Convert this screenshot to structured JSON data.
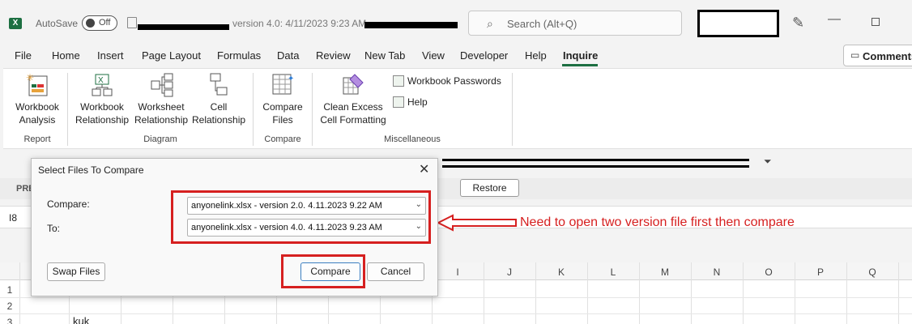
{
  "titlebar": {
    "app_icon": "X",
    "autosave_label": "AutoSave",
    "autosave_state": "Off",
    "doc_title": "version 4.0: 4/11/2023 9:23 AM",
    "search_placeholder": "Search (Alt+Q)",
    "icons": [
      "excel-icon",
      "save-icon",
      "search-icon",
      "pen-icon",
      "minimize-icon",
      "maximize-icon"
    ]
  },
  "menu": {
    "tabs": [
      "File",
      "Home",
      "Insert",
      "Page Layout",
      "Formulas",
      "Data",
      "Review",
      "New Tab",
      "View",
      "Developer",
      "Help",
      "Inquire"
    ],
    "active_tab": "Inquire",
    "comments_label": "Comments"
  },
  "ribbon": {
    "groups": {
      "report": "Report",
      "diagram": "Diagram",
      "compare": "Compare",
      "misc": "Miscellaneous"
    },
    "buttons": {
      "workbook_analysis": [
        "Workbook",
        "Analysis"
      ],
      "workbook_relationship": [
        "Workbook",
        "Relationship"
      ],
      "worksheet_relationship": [
        "Worksheet",
        "Relationship"
      ],
      "cell_relationship": [
        "Cell",
        "Relationship"
      ],
      "compare_files": [
        "Compare",
        "Files"
      ],
      "clean_excess": [
        "Clean Excess",
        "Cell Formatting"
      ],
      "workbook_passwords": "Workbook Passwords",
      "help": "Help"
    }
  },
  "strip": {
    "prev_label": "PRE",
    "restore_label": "Restore",
    "cell_ref": "I8",
    "quick_left": "P"
  },
  "dialog": {
    "title": "Select Files To Compare",
    "compare_label": "Compare:",
    "to_label": "To:",
    "compare_value": "anyonelink.xlsx  -  version 2.0. 4.11.2023 9.22 AM",
    "to_value": "anyonelink.xlsx  -  version 4.0. 4.11.2023 9.23 AM",
    "swap_label": "Swap Files",
    "compare_button": "Compare",
    "cancel_button": "Cancel"
  },
  "annotation": {
    "text": "Need to open two version file first then compare",
    "color": "#d62020"
  },
  "grid": {
    "columns": [
      "I",
      "J",
      "K",
      "L",
      "M",
      "N",
      "O",
      "P",
      "Q"
    ],
    "rows": [
      "1",
      "2",
      "3"
    ],
    "cell_text": "kuk"
  },
  "colors": {
    "excel_green": "#1d6f42",
    "annotation_red": "#d62020"
  }
}
